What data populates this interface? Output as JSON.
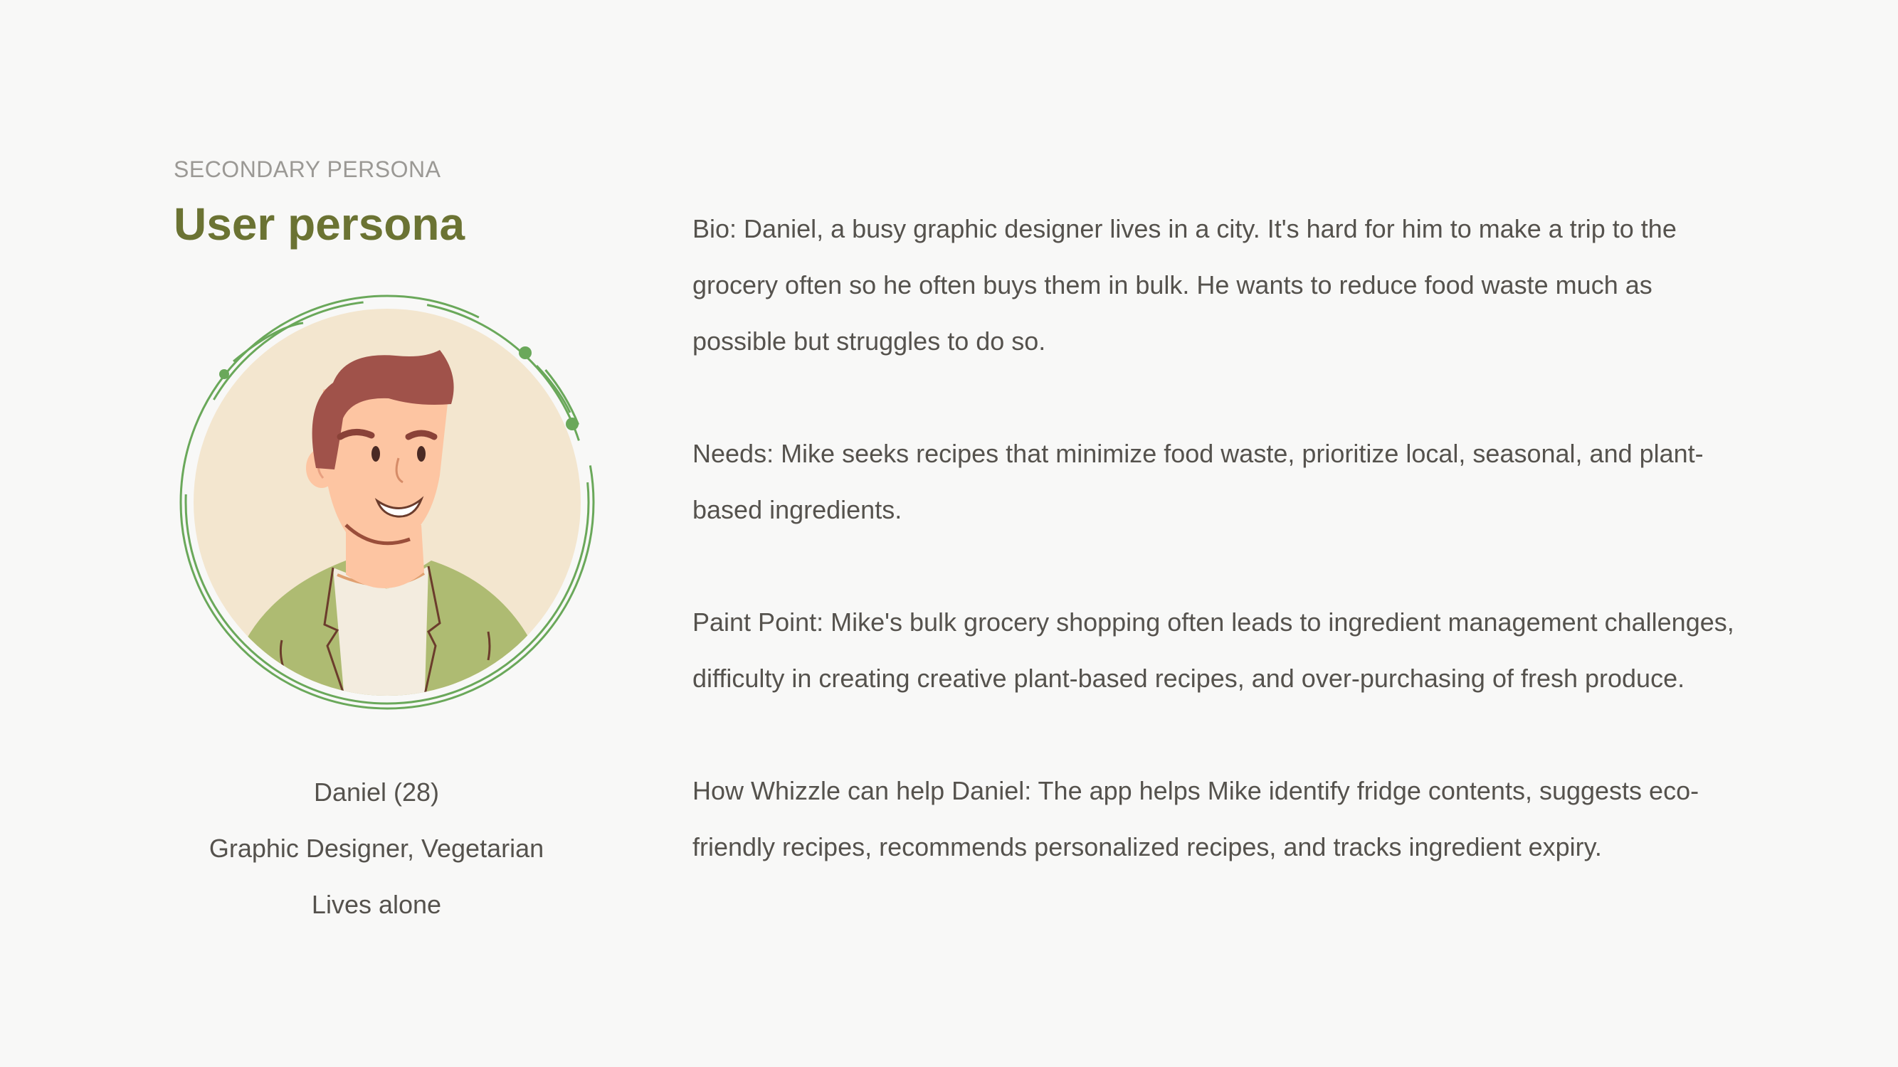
{
  "header": {
    "eyebrow": "SECONDARY PERSONA",
    "title": "User persona"
  },
  "persona": {
    "name_age": "Daniel (28)",
    "role": "Graphic Designer, Vegetarian",
    "living": "Lives alone"
  },
  "sections": {
    "bio": "Bio: Daniel, a busy graphic designer lives in a city. It's hard for him to make a trip to the grocery often so he often buys them in bulk. He wants to reduce food waste much as possible but struggles to do so.",
    "needs": "Needs: Mike seeks recipes that minimize food waste, prioritize local, seasonal, and plant-based ingredients.",
    "pain_point": "Paint Point: Mike's bulk grocery shopping often leads to ingredient management challenges, difficulty in creating creative plant-based recipes, and over-purchasing of fresh produce.",
    "help": "How Whizzle can help Daniel: The app helps Mike identify fridge contents, suggests eco-friendly recipes, recommends personalized recipes, and tracks ingredient expiry."
  },
  "colors": {
    "title_green": "#6b7333",
    "ring_green": "#6aa85a",
    "avatar_bg": "#f3e6cf",
    "hair": "#a0524a",
    "skin": "#fdc5a2",
    "jacket": "#aebb72"
  },
  "icons": {
    "avatar": "user-avatar-illustration"
  }
}
